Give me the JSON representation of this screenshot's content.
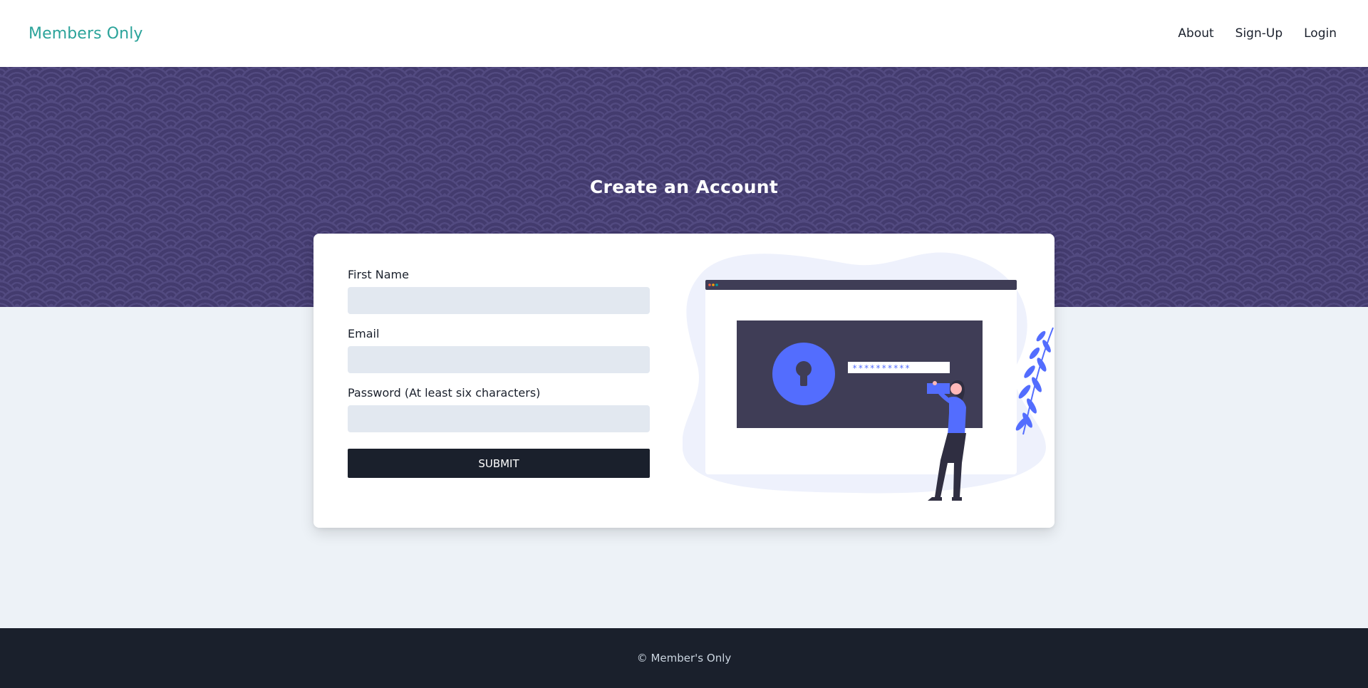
{
  "header": {
    "brand": "Members Only",
    "nav": [
      {
        "label": "About"
      },
      {
        "label": "Sign-Up"
      },
      {
        "label": "Login"
      }
    ]
  },
  "hero": {
    "title": "Create an Account"
  },
  "form": {
    "fields": [
      {
        "label": "First Name",
        "value": "",
        "placeholder": ""
      },
      {
        "label": "Email",
        "value": "",
        "placeholder": ""
      },
      {
        "label": "Password (At least six characters)",
        "value": "",
        "placeholder": ""
      }
    ],
    "submit_label": "SUBMIT"
  },
  "illustration": {
    "password_mask": "**********",
    "accent_color": "#536dfe",
    "panel_color": "#3f3d56"
  },
  "footer": {
    "copyright": "© Member's Only"
  },
  "colors": {
    "brand": "#2ba39a",
    "hero_bg": "#433b6e",
    "page_bg": "#edf2f7",
    "dark": "#1a202c",
    "input_bg": "#e2e8f0"
  }
}
